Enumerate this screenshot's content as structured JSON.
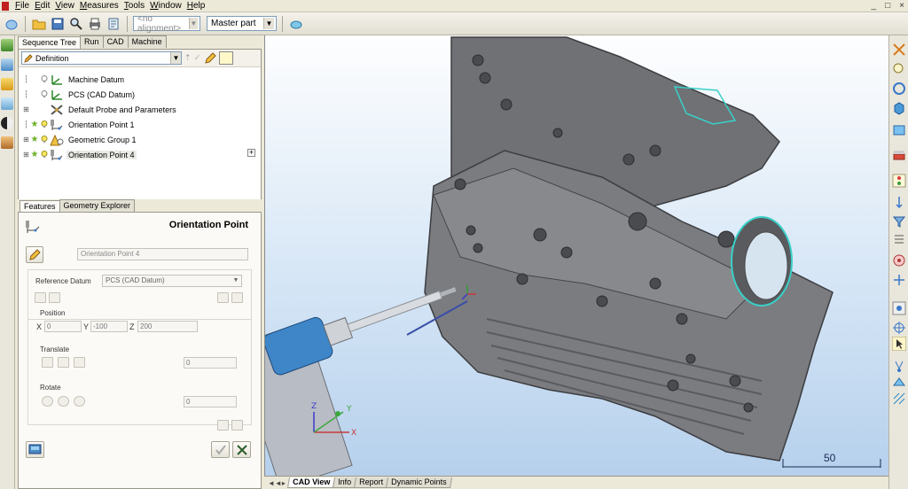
{
  "menu": [
    "File",
    "Edit",
    "View",
    "Measures",
    "Tools",
    "Window",
    "Help"
  ],
  "window_controls": [
    "_",
    "□",
    "×"
  ],
  "toolbar": {
    "alignment_placeholder": "<no alignment>",
    "part_value": "Master part"
  },
  "left_tabs": [
    "Sequence Tree",
    "Run",
    "CAD",
    "Machine"
  ],
  "tree": {
    "definition_label": "Definition",
    "items": [
      {
        "label": "Machine Datum",
        "icon": "datum-axes-icon"
      },
      {
        "label": "PCS (CAD Datum)",
        "icon": "datum-axes-icon"
      },
      {
        "label": "Default Probe and Parameters",
        "icon": "probe-params-icon"
      },
      {
        "label": "Orientation Point 1",
        "icon": "probe-point-icon"
      },
      {
        "label": "Geometric Group 1",
        "icon": "geometric-group-icon"
      },
      {
        "label": "Orientation Point 4",
        "icon": "probe-point-icon"
      }
    ]
  },
  "feature_tabs": [
    "Features",
    "Geometry Explorer"
  ],
  "feature": {
    "title": "Orientation Point",
    "name_value": "Orientation Point 4",
    "reference_datum_label": "Reference Datum",
    "reference_datum_value": "PCS (CAD Datum)",
    "position_label": "Position",
    "x_label": "X",
    "x_value": "0",
    "y_label": "Y",
    "y_value": "-100",
    "z_label": "Z",
    "z_value": "200",
    "translate_label": "Translate",
    "translate_value": "0",
    "rotate_label": "Rotate",
    "rotate_value": "0"
  },
  "viewport": {
    "scale_value": "50",
    "triad_labels": {
      "x": "X",
      "y": "Y",
      "z": "Z"
    }
  },
  "view_tabs": [
    "CAD View",
    "Info",
    "Report",
    "Dynamic Points"
  ],
  "colors": {
    "accent_blue": "#3a78c8",
    "part_gray": "#6f7175",
    "highlight_cyan": "#3ad0c8",
    "probe_blue": "#4a8ac4",
    "star_green": "#6db12a"
  }
}
